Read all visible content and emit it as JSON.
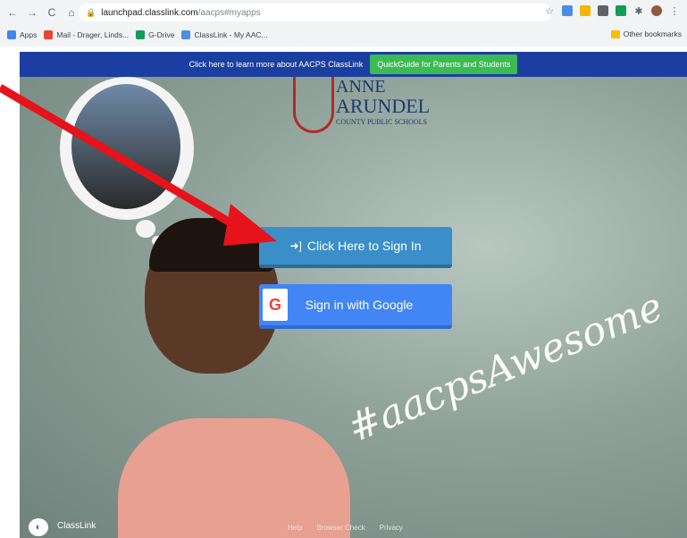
{
  "browser": {
    "url_host": "launchpad.classlink.com",
    "url_path": "/aacps#myapps",
    "nav_back": "←",
    "nav_forward": "→",
    "nav_reload": "C",
    "nav_home": "⌂",
    "bookmarks": [
      {
        "label": "Apps",
        "color": "#4285f4"
      },
      {
        "label": "Mail - Drager, Linds...",
        "color": "#ea4335"
      },
      {
        "label": "G-Drive",
        "color": "#0f9d58"
      },
      {
        "label": "ClassLink - My AAC...",
        "color": "#4a90e2"
      }
    ],
    "other_bookmarks": "Other bookmarks"
  },
  "banner": {
    "text": "Click here to learn more about AACPS ClassLink",
    "button": "QuickGuide for Parents and Students"
  },
  "logo": {
    "line1": "ANNE",
    "line2": "ARUNDEL",
    "line3": "COUNTY PUBLIC SCHOOLS"
  },
  "signin": {
    "label": "Click Here to Sign In",
    "google_label": "Sign in with Google",
    "google_glyph": "G"
  },
  "hashtag": "#aacpsAwesome",
  "footer": {
    "brand": "ClassLink",
    "links": [
      "Help",
      "Browser Check",
      "Privacy"
    ]
  },
  "annotation": {
    "arrow_color": "#e8121a"
  }
}
